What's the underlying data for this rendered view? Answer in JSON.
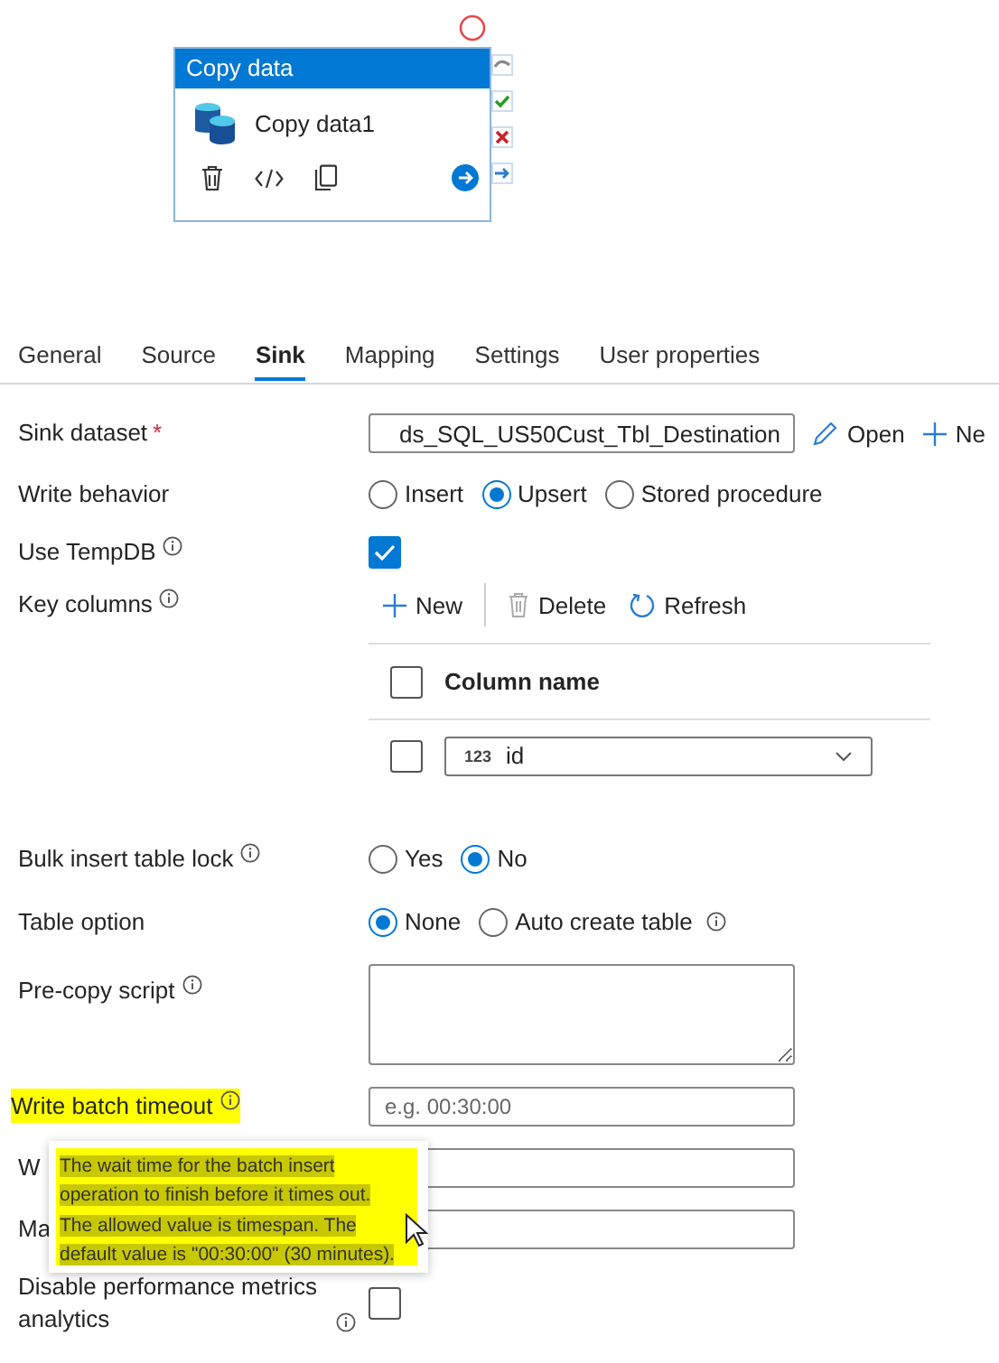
{
  "activity": {
    "title": "Copy data",
    "name": "Copy data1"
  },
  "tabs": [
    {
      "label": "General",
      "selected": false
    },
    {
      "label": "Source",
      "selected": false
    },
    {
      "label": "Sink",
      "selected": true
    },
    {
      "label": "Mapping",
      "selected": false
    },
    {
      "label": "Settings",
      "selected": false
    },
    {
      "label": "User properties",
      "selected": false
    }
  ],
  "form": [
    {
      "kind": "dropdown",
      "label": "Sink dataset",
      "required_mark": "*",
      "value": "ds_SQL_US50Cust_Tbl_Destination",
      "actions": [
        {
          "kind": "edit",
          "label": "Open"
        },
        {
          "kind": "add",
          "label": "Ne"
        }
      ]
    },
    {
      "kind": "radio",
      "label": "Write behavior",
      "options": [
        {
          "label": "Insert",
          "selected": false
        },
        {
          "label": "Upsert",
          "selected": true
        },
        {
          "label": "Stored procedure",
          "selected": false
        }
      ]
    },
    {
      "kind": "checkbox",
      "label": "Use TempDB",
      "info": true,
      "checked": true
    },
    {
      "kind": "key_table",
      "label": "Key columns",
      "info": true,
      "toolbar": [
        {
          "kind": "add",
          "label": "New"
        },
        {
          "kind": "delete",
          "label": "Delete"
        },
        {
          "kind": "refresh",
          "label": "Refresh"
        }
      ],
      "header": "Column name",
      "header_checked": false,
      "rows": [
        {
          "type": "123",
          "value": "id",
          "checked": false
        }
      ]
    },
    {
      "kind": "radio",
      "label": "Bulk insert table lock",
      "info": true,
      "options": [
        {
          "label": "Yes",
          "selected": false
        },
        {
          "label": "No",
          "selected": true
        }
      ]
    },
    {
      "kind": "radio",
      "label": "Table option",
      "options": [
        {
          "label": "None",
          "selected": true
        },
        {
          "label": "Auto create table",
          "selected": false,
          "info": true
        }
      ]
    },
    {
      "kind": "textarea",
      "label": "Pre-copy script",
      "info": true
    },
    {
      "kind": "input",
      "label": "Write batch timeout",
      "info": true,
      "highlighted": true,
      "placeholder": "e.g. 00:30:00"
    },
    {
      "kind": "input",
      "label": "W"
    },
    {
      "kind": "input",
      "label": "Ma"
    },
    {
      "kind": "checkbox",
      "label": "Disable performance metrics analytics",
      "info": true,
      "checked": false
    }
  ],
  "tooltip": {
    "text": "The wait time for the batch insert operation to finish before it times out. The allowed value is timespan. The default value is \"00:30:00\" (30 minutes)."
  }
}
